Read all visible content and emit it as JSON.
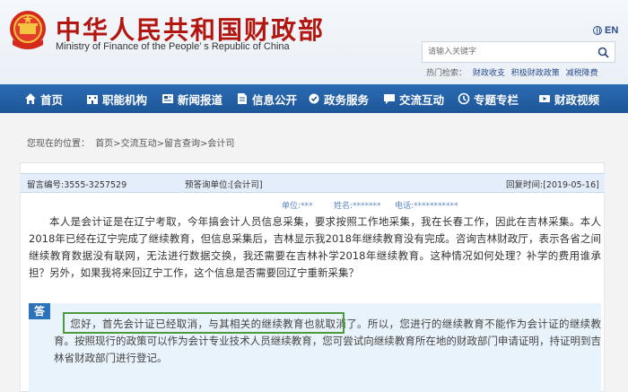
{
  "header": {
    "title_cn": "中华人民共和国财政部",
    "title_en": "Ministry of Finance of the People’ s Republic of China",
    "lang_label": "EN",
    "search_placeholder": "请输入关键字",
    "hot_label": "热门检索：",
    "hot_links": [
      "财政收支",
      "积极财政政策",
      "减税降费"
    ]
  },
  "nav": {
    "items": [
      {
        "label": "首页",
        "icon": "home-icon"
      },
      {
        "label": "职能机构",
        "icon": "building-icon"
      },
      {
        "label": "新闻报道",
        "icon": "news-icon"
      },
      {
        "label": "信息公开",
        "icon": "document-icon"
      },
      {
        "label": "政务服务",
        "icon": "service-icon"
      },
      {
        "label": "交流互动",
        "icon": "chat-icon"
      },
      {
        "label": "专题专栏",
        "icon": "topic-icon"
      },
      {
        "label": "财政视频",
        "icon": "video-icon"
      }
    ]
  },
  "breadcrumb": {
    "label": "您现在的位置：",
    "path": "首页>交流互动>留言查询>会计司"
  },
  "message": {
    "id_label": "留言编号:3555-3257529",
    "dept_label": "预答询单位:[会计司]",
    "date_label": "回复时间:[2019-05-16]",
    "unit": "单位:***",
    "name": "姓名:*******",
    "phone": "电话:***********",
    "question": "本人是会计证是在辽宁考取，今年搞会计人员信息采集，要求按照工作地采集，我在长春工作，因此在吉林采集。本人2018年已经在辽宁完成了继续教育，但信息采集后，吉林显示我2018年继续教育没有完成。咨询吉林财政厅，表示各省之间继续教育数据没有联网，无法进行数据交换，我还需要在吉林补学2018年继续教育。这种情况如何处理？补学的费用谁承担？另外，如果我将来回辽宁工作，这个信息是否需要回辽宁重新采集？",
    "answer_tag": "答",
    "answer": "您好，首先会计证已经取消，与其相关的继续教育也就取消了。所以，您进行的继续教育不能作为会计证的继续教育。按照现行的政策可以作为会计专业技术人员继续教育，您可尝试向继续教育所在地的财政部门申请证明，持证明到吉林省财政部门进行登记。"
  },
  "colors": {
    "brand_red": "#b2160f",
    "nav_blue": "#1e5599",
    "highlight_green": "#4b9a3d"
  }
}
